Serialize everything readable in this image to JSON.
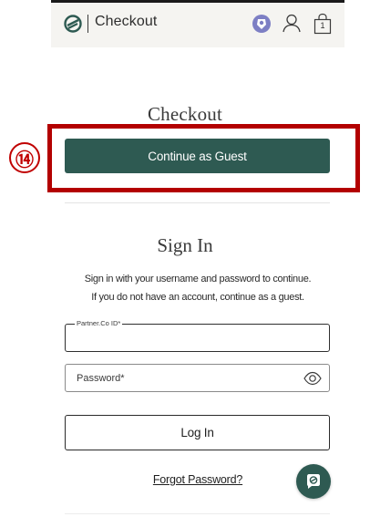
{
  "header": {
    "title": "Checkout",
    "icons": [
      "brand-logo-icon",
      "language-flag-icon",
      "user-icon",
      "cart-icon"
    ],
    "cart_count": "1"
  },
  "checkout": {
    "heading": "Checkout",
    "guest_button_label": "Continue as Guest"
  },
  "annotation": {
    "number": "⑭",
    "color": "#c00000"
  },
  "signin": {
    "heading": "Sign In",
    "description_line1": "Sign in with your username and password to continue.",
    "description_line2": "If you do not have an account, continue as a guest.",
    "partner_id_label": "Partner.Co ID*",
    "partner_id_value": "",
    "password_placeholder": "Password*",
    "login_button_label": "Log In",
    "forgot_password_label": "Forgot Password?"
  },
  "colors": {
    "brand_green": "#2e5a52",
    "header_bg": "#f5f4f1",
    "annotation_red": "#b30000"
  }
}
